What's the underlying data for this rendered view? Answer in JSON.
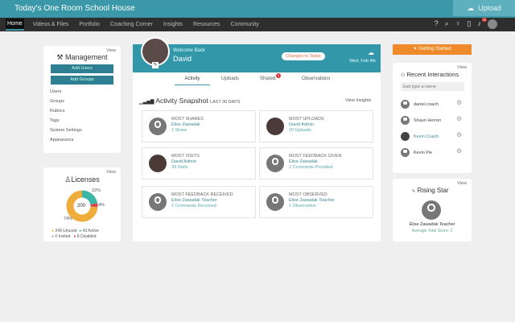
{
  "header": {
    "title": "Today's One Room School House",
    "upload_label": "Upload"
  },
  "nav": {
    "items": [
      "Home",
      "Videos & Files",
      "Portfolio",
      "Coaching Corner",
      "Insights",
      "Resources",
      "Community"
    ],
    "notification_count": "22"
  },
  "management": {
    "view": "View",
    "title": "Management",
    "add_users": "Add Users",
    "add_groups": "Add Groups",
    "links": [
      "Users",
      "Groups",
      "Rubrics",
      "Tags",
      "System Settings",
      "Appearance"
    ]
  },
  "licenses": {
    "view": "View",
    "title": "Licenses",
    "total": "200",
    "pct_unused": "74%",
    "pct_active": "22%",
    "pct_disabled": "4%",
    "legend": [
      "349 Unused",
      "43 Active",
      "0 Invited",
      "8 Disabled"
    ],
    "slices": [
      {
        "label": "Unused",
        "pct": 74,
        "color": "#f0ad3c"
      },
      {
        "label": "Active",
        "pct": 22,
        "color": "#3bb5a6"
      },
      {
        "label": "Disabled",
        "pct": 4,
        "color": "#d9434e"
      }
    ]
  },
  "welcome": {
    "greeting": "Welcome Back",
    "name": "David",
    "changes_label": "Changes to Tasks",
    "date": "Wed, Feb 4th"
  },
  "tabs": {
    "items": [
      "Activity",
      "Uploads",
      "Shared",
      "Observations"
    ],
    "shared_badge": "2",
    "active": "Activity"
  },
  "snapshot": {
    "title": "Activity Snapshot",
    "range": "LAST 30 DAYS",
    "view_insights": "View Insights",
    "cards": [
      {
        "title": "MOST SHARES",
        "name": "Elise Zawadak",
        "value": "1 Share"
      },
      {
        "title": "MOST UPLOADS",
        "name": "David Admin",
        "value": "20 Uploads"
      },
      {
        "title": "MOST VISITS",
        "name": "David Admin",
        "value": "39 Visits"
      },
      {
        "title": "MOST FEEDBACK GIVEN",
        "name": "Elise Zawadak",
        "value": "2 Comments Provided"
      },
      {
        "title": "MOST FEEDBACK RECEIVED",
        "name": "Elise Zawadak Teacher",
        "value": "2 Comments Received"
      },
      {
        "title": "MOST OBSERVED",
        "name": "Elise Zawadak Teacher",
        "value": "1 Observation"
      }
    ]
  },
  "get_started": "Getting Started",
  "recent": {
    "view": "View",
    "title": "Recent Interactions",
    "placeholder": "Just type a name",
    "people": [
      "daniel.coach",
      "Shaun Herron",
      "Kevin Coach",
      "Kevin Pie"
    ]
  },
  "rising": {
    "view": "View",
    "title": "Rising Star",
    "name": "Elise Zawadak Teacher",
    "score": "Average Total Score: 2"
  }
}
